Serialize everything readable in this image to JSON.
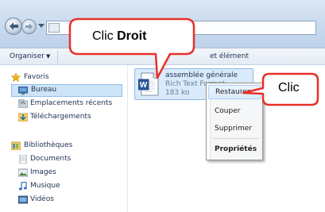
{
  "toolbar": {
    "organize_label": "Organiser",
    "organize_arrow": "▼",
    "new_folder_partial": "et élément"
  },
  "sidebar": {
    "favorites_header": "Favoris",
    "favorites": [
      {
        "label": "Bureau",
        "icon": "desktop-icon",
        "selected": true
      },
      {
        "label": "Emplacements récents",
        "icon": "recent-places-icon"
      },
      {
        "label": "Téléchargements",
        "icon": "downloads-icon"
      }
    ],
    "libraries_header": "Bibliothèques",
    "libraries": [
      {
        "label": "Documents",
        "icon": "documents-icon"
      },
      {
        "label": "Images",
        "icon": "images-icon"
      },
      {
        "label": "Musique",
        "icon": "music-icon"
      },
      {
        "label": "Vidéos",
        "icon": "videos-icon"
      }
    ]
  },
  "file": {
    "name": "assemblée générale",
    "type": "Rich Text Format",
    "size": "183 ko",
    "icon": "word-document-icon"
  },
  "context_menu": {
    "items": [
      {
        "label": "Restaurer",
        "highlight": true
      },
      {
        "label": "Couper"
      },
      {
        "label": "Supprimer"
      },
      {
        "label": "Propriétés",
        "bold": true
      }
    ]
  },
  "callouts": {
    "right_click_prefix": "Clic ",
    "right_click_bold": "Droit",
    "click": "Clic"
  },
  "colors": {
    "callout_border": "#e8302a",
    "selection": "#cde3f8"
  }
}
